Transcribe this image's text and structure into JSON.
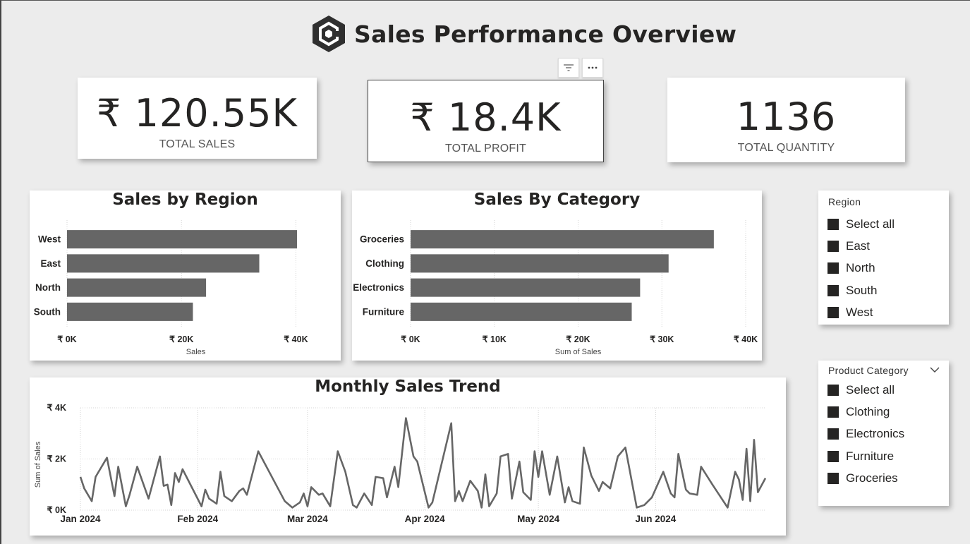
{
  "header": {
    "title": "Sales Performance Overview"
  },
  "kpis": {
    "total_sales": {
      "value": "₹ 120.55K",
      "label": "TOTAL SALES"
    },
    "total_profit": {
      "value": "₹ 18.4K",
      "label": "TOTAL PROFIT"
    },
    "total_quantity": {
      "value": "1136",
      "label": "TOTAL QUANTITY"
    }
  },
  "icons": {
    "logo": "hexagon-logo-icon",
    "filter": "filter-icon",
    "more": "more-options-icon",
    "chevron": "chevron-down-icon"
  },
  "colors": {
    "bar": "#666666",
    "line": "#666666",
    "card": "#ffffff",
    "background": "#ececec"
  },
  "slicers": {
    "region": {
      "title": "Region",
      "items": [
        "Select all",
        "East",
        "North",
        "South",
        "West"
      ]
    },
    "category": {
      "title": "Product Category",
      "items": [
        "Select all",
        "Clothing",
        "Electronics",
        "Furniture",
        "Groceries"
      ]
    }
  },
  "chart_data": [
    {
      "type": "bar",
      "orientation": "horizontal",
      "title": "Sales by Region",
      "xlabel": "Sales",
      "ylabel": "",
      "categories": [
        "West",
        "East",
        "North",
        "South"
      ],
      "values": [
        40200,
        33600,
        24300,
        22000
      ],
      "xlim": [
        0,
        45000
      ],
      "xticks": [
        {
          "v": 0,
          "label": "₹ 0K"
        },
        {
          "v": 20000,
          "label": "₹ 20K"
        },
        {
          "v": 40000,
          "label": "₹ 40K"
        }
      ],
      "grid": true
    },
    {
      "type": "bar",
      "orientation": "horizontal",
      "title": "Sales By Category",
      "xlabel": "Sum of Sales",
      "ylabel": "",
      "categories": [
        "Groceries",
        "Clothing",
        "Electronics",
        "Furniture"
      ],
      "values": [
        36200,
        30800,
        27400,
        26400
      ],
      "xlim": [
        0,
        40000
      ],
      "xticks": [
        {
          "v": 0,
          "label": "₹ 0K"
        },
        {
          "v": 10000,
          "label": "₹ 10K"
        },
        {
          "v": 20000,
          "label": "₹ 20K"
        },
        {
          "v": 30000,
          "label": "₹ 30K"
        },
        {
          "v": 40000,
          "label": "₹ 40K"
        }
      ],
      "grid": true
    },
    {
      "type": "line",
      "title": "Monthly Sales Trend",
      "xlabel": "",
      "ylabel": "Sum of Sales",
      "ylim": [
        0,
        4000
      ],
      "yticks": [
        {
          "v": 0,
          "label": "₹ 0K"
        },
        {
          "v": 2000,
          "label": "₹ 2K"
        },
        {
          "v": 4000,
          "label": "₹ 4K"
        }
      ],
      "xticks": [
        {
          "v": "2024-01-01",
          "label": "Jan 2024"
        },
        {
          "v": "2024-02-01",
          "label": "Feb 2024"
        },
        {
          "v": "2024-03-01",
          "label": "Mar 2024"
        },
        {
          "v": "2024-04-01",
          "label": "Apr 2024"
        },
        {
          "v": "2024-05-01",
          "label": "May 2024"
        },
        {
          "v": "2024-06-01",
          "label": "Jun 2024"
        }
      ],
      "xlim": [
        "2024-01-01",
        "2024-06-30"
      ],
      "grid": true,
      "x": [
        "2024-01-01",
        "2024-01-02",
        "2024-01-04",
        "2024-01-05",
        "2024-01-08",
        "2024-01-10",
        "2024-01-11",
        "2024-01-13",
        "2024-01-14",
        "2024-01-16",
        "2024-01-19",
        "2024-01-22",
        "2024-01-23",
        "2024-01-24",
        "2024-01-25",
        "2024-01-26",
        "2024-01-27",
        "2024-01-28",
        "2024-02-02",
        "2024-02-03",
        "2024-02-04",
        "2024-02-06",
        "2024-02-07",
        "2024-02-08",
        "2024-02-10",
        "2024-02-12",
        "2024-02-13",
        "2024-02-14",
        "2024-02-17",
        "2024-02-24",
        "2024-02-26",
        "2024-02-28",
        "2024-02-29",
        "2024-03-01",
        "2024-03-02",
        "2024-03-04",
        "2024-03-05",
        "2024-03-07",
        "2024-03-09",
        "2024-03-11",
        "2024-03-13",
        "2024-03-14",
        "2024-03-16",
        "2024-03-18",
        "2024-03-19",
        "2024-03-21",
        "2024-03-22",
        "2024-03-24",
        "2024-03-25",
        "2024-03-27",
        "2024-03-29",
        "2024-03-30",
        "2024-04-02",
        "2024-04-03",
        "2024-04-08",
        "2024-04-09",
        "2024-04-10",
        "2024-04-11",
        "2024-04-13",
        "2024-04-15",
        "2024-04-16",
        "2024-04-17",
        "2024-04-18",
        "2024-04-20",
        "2024-04-21",
        "2024-04-23",
        "2024-04-24",
        "2024-04-26",
        "2024-04-27",
        "2024-04-29",
        "2024-04-30",
        "2024-05-01",
        "2024-05-02",
        "2024-05-04",
        "2024-05-06",
        "2024-05-08",
        "2024-05-09",
        "2024-05-10",
        "2024-05-12",
        "2024-05-13",
        "2024-05-15",
        "2024-05-17",
        "2024-05-18",
        "2024-05-20",
        "2024-05-22",
        "2024-05-24",
        "2024-05-27",
        "2024-05-29",
        "2024-05-31",
        "2024-06-03",
        "2024-06-05",
        "2024-06-06",
        "2024-06-07",
        "2024-06-09",
        "2024-06-10",
        "2024-06-12",
        "2024-06-13",
        "2024-06-16",
        "2024-06-20",
        "2024-06-22",
        "2024-06-23",
        "2024-06-24",
        "2024-06-25",
        "2024-06-26",
        "2024-06-27",
        "2024-06-28",
        "2024-06-30"
      ],
      "values": [
        1300,
        850,
        350,
        1300,
        2050,
        550,
        1700,
        150,
        600,
        1700,
        450,
        2100,
        950,
        1000,
        200,
        1450,
        1100,
        1600,
        150,
        800,
        450,
        250,
        1500,
        550,
        350,
        750,
        850,
        600,
        2300,
        350,
        100,
        300,
        650,
        150,
        900,
        600,
        650,
        150,
        2300,
        1500,
        200,
        100,
        650,
        200,
        1300,
        1250,
        500,
        1700,
        900,
        3600,
        2100,
        1900,
        100,
        300,
        3400,
        350,
        750,
        350,
        1150,
        750,
        100,
        1400,
        150,
        650,
        2100,
        2200,
        450,
        1900,
        700,
        400,
        2300,
        1300,
        2300,
        600,
        2100,
        300,
        900,
        350,
        250,
        2450,
        1350,
        750,
        1100,
        850,
        2100,
        2450,
        100,
        200,
        500,
        1500,
        650,
        500,
        2200,
        800,
        650,
        600,
        1700,
        1000,
        100,
        1500,
        1200,
        400,
        2400,
        350,
        2750,
        700,
        1250
      ]
    }
  ]
}
